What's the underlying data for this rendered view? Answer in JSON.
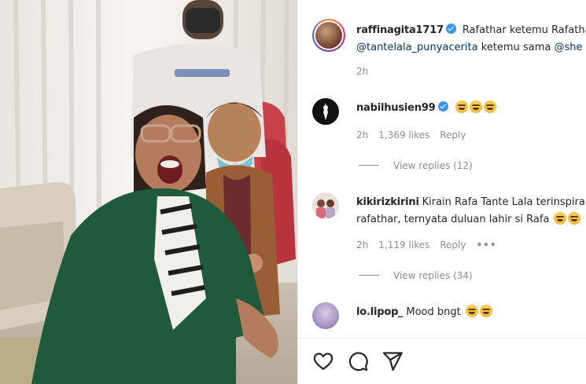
{
  "post": {
    "author": "raffinagita1717",
    "caption_text": "Rafathar ketemu Rafatha",
    "caption_line2_mention1": "@tantelala_punyacerita",
    "caption_line2_mid": " ketemu sama ",
    "caption_line2_mention2": "@she",
    "time": "2h"
  },
  "comments": [
    {
      "user": "nabilhusien99",
      "verified": true,
      "text": "",
      "emojis": 3,
      "time": "2h",
      "likes": "1,369 likes",
      "reply": "Reply",
      "view_replies": "View replies (12)"
    },
    {
      "user": "kikirizkirini",
      "verified": false,
      "text": "Kirain Rafa Tante Lala terinspira",
      "text_line2": "rafathar, ternyata duluan lahir si Rafa",
      "emojis": 2,
      "time": "2h",
      "likes": "1,119 likes",
      "reply": "Reply",
      "more": "•••",
      "view_replies": "View replies (34)"
    },
    {
      "user": "lo.lipop_",
      "verified": false,
      "text": "Mood bngt",
      "emojis": 2
    }
  ],
  "actions": {
    "like": "heart-icon",
    "comment": "comment-icon",
    "share": "share-icon"
  },
  "colors": {
    "text": "#262626",
    "muted": "#8e8e8e",
    "mention": "#00376b",
    "verified": "#3897f0",
    "border": "#efefef"
  }
}
